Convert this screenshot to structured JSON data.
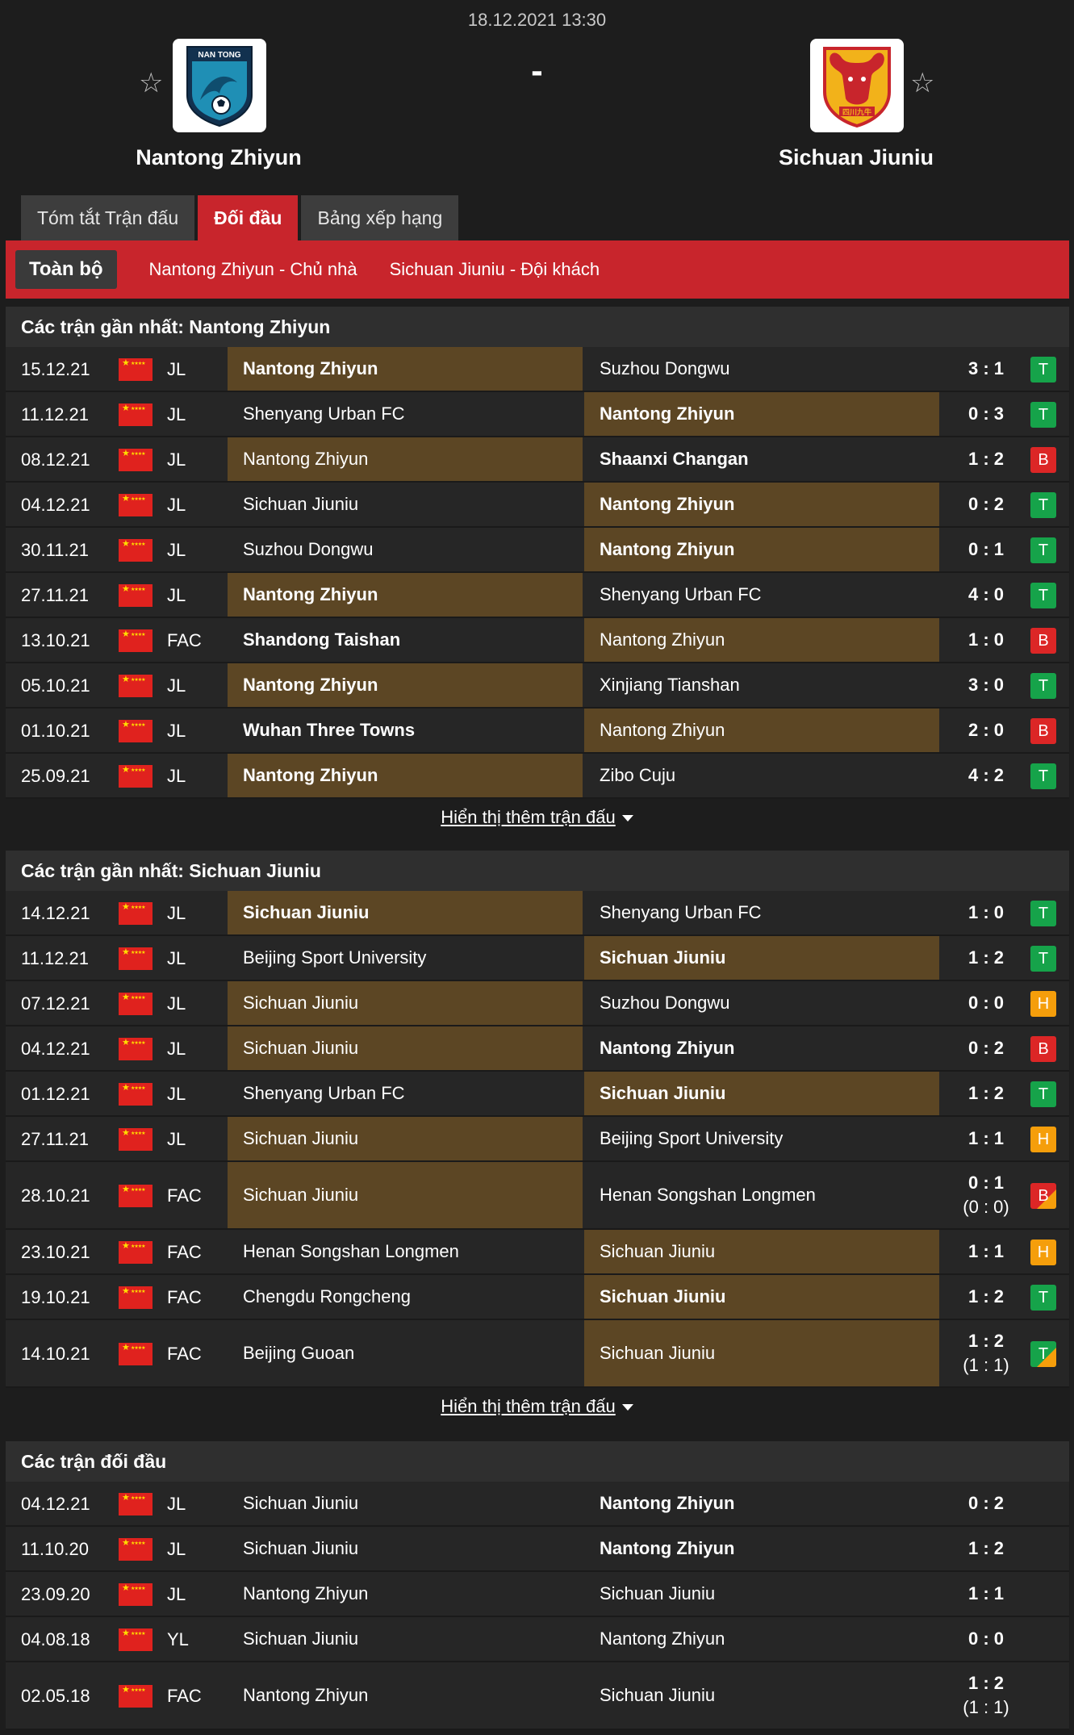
{
  "header": {
    "datetime": "18.12.2021 13:30",
    "score": "-",
    "home_team": "Nantong Zhiyun",
    "away_team": "Sichuan Jiuniu",
    "star_icon": "☆",
    "home_logo_text": "NAN TONG",
    "away_logo_text": "四川九牛"
  },
  "tabs": [
    "Tóm tắt Trận đấu",
    "Đối đầu",
    "Bảng xếp hạng"
  ],
  "subtabs": [
    "Toàn bộ",
    "Nantong Zhiyun - Chủ nhà",
    "Sichuan Jiuniu - Đội khách"
  ],
  "colors": {
    "accent_red": "#c8252c",
    "highlight_brown": "#5c4624",
    "win": "#16a34a",
    "loss": "#dc2626",
    "draw": "#f59e0b"
  },
  "sections": [
    {
      "title": "Các trận gần nhất: Nantong Zhiyun",
      "show_more": "Hiển thị thêm trận đấu",
      "rows": [
        {
          "date": "15.12.21",
          "league": "JL",
          "home": "Nantong Zhiyun",
          "away": "Suzhou Dongwu",
          "score": "3 : 1",
          "sub": "",
          "result": "T",
          "hl": "home",
          "bold": "home"
        },
        {
          "date": "11.12.21",
          "league": "JL",
          "home": "Shenyang Urban FC",
          "away": "Nantong Zhiyun",
          "score": "0 : 3",
          "sub": "",
          "result": "T",
          "hl": "away",
          "bold": "away"
        },
        {
          "date": "08.12.21",
          "league": "JL",
          "home": "Nantong Zhiyun",
          "away": "Shaanxi Changan",
          "score": "1 : 2",
          "sub": "",
          "result": "B",
          "hl": "home",
          "bold": "away"
        },
        {
          "date": "04.12.21",
          "league": "JL",
          "home": "Sichuan Jiuniu",
          "away": "Nantong Zhiyun",
          "score": "0 : 2",
          "sub": "",
          "result": "T",
          "hl": "away",
          "bold": "away"
        },
        {
          "date": "30.11.21",
          "league": "JL",
          "home": "Suzhou Dongwu",
          "away": "Nantong Zhiyun",
          "score": "0 : 1",
          "sub": "",
          "result": "T",
          "hl": "away",
          "bold": "away"
        },
        {
          "date": "27.11.21",
          "league": "JL",
          "home": "Nantong Zhiyun",
          "away": "Shenyang Urban FC",
          "score": "4 : 0",
          "sub": "",
          "result": "T",
          "hl": "home",
          "bold": "home"
        },
        {
          "date": "13.10.21",
          "league": "FAC",
          "home": "Shandong Taishan",
          "away": "Nantong Zhiyun",
          "score": "1 : 0",
          "sub": "",
          "result": "B",
          "hl": "away",
          "bold": "home"
        },
        {
          "date": "05.10.21",
          "league": "JL",
          "home": "Nantong Zhiyun",
          "away": "Xinjiang Tianshan",
          "score": "3 : 0",
          "sub": "",
          "result": "T",
          "hl": "home",
          "bold": "home"
        },
        {
          "date": "01.10.21",
          "league": "JL",
          "home": "Wuhan Three Towns",
          "away": "Nantong Zhiyun",
          "score": "2 : 0",
          "sub": "",
          "result": "B",
          "hl": "away",
          "bold": "home"
        },
        {
          "date": "25.09.21",
          "league": "JL",
          "home": "Nantong Zhiyun",
          "away": "Zibo Cuju",
          "score": "4 : 2",
          "sub": "",
          "result": "T",
          "hl": "home",
          "bold": "home"
        }
      ]
    },
    {
      "title": "Các trận gần nhất: Sichuan Jiuniu",
      "show_more": "Hiển thị thêm trận đấu",
      "rows": [
        {
          "date": "14.12.21",
          "league": "JL",
          "home": "Sichuan Jiuniu",
          "away": "Shenyang Urban FC",
          "score": "1 : 0",
          "sub": "",
          "result": "T",
          "hl": "home",
          "bold": "home"
        },
        {
          "date": "11.12.21",
          "league": "JL",
          "home": "Beijing Sport University",
          "away": "Sichuan Jiuniu",
          "score": "1 : 2",
          "sub": "",
          "result": "T",
          "hl": "away",
          "bold": "away"
        },
        {
          "date": "07.12.21",
          "league": "JL",
          "home": "Sichuan Jiuniu",
          "away": "Suzhou Dongwu",
          "score": "0 : 0",
          "sub": "",
          "result": "H",
          "hl": "home",
          "bold": ""
        },
        {
          "date": "04.12.21",
          "league": "JL",
          "home": "Sichuan Jiuniu",
          "away": "Nantong Zhiyun",
          "score": "0 : 2",
          "sub": "",
          "result": "B",
          "hl": "home",
          "bold": "away"
        },
        {
          "date": "01.12.21",
          "league": "JL",
          "home": "Shenyang Urban FC",
          "away": "Sichuan Jiuniu",
          "score": "1 : 2",
          "sub": "",
          "result": "T",
          "hl": "away",
          "bold": "away"
        },
        {
          "date": "27.11.21",
          "league": "JL",
          "home": "Sichuan Jiuniu",
          "away": "Beijing Sport University",
          "score": "1 : 1",
          "sub": "",
          "result": "H",
          "hl": "home",
          "bold": ""
        },
        {
          "date": "28.10.21",
          "league": "FAC",
          "home": "Sichuan Jiuniu",
          "away": "Henan Songshan Longmen",
          "score": "0 : 1",
          "sub": "(0 : 0)",
          "result": "BH",
          "hl": "home",
          "bold": ""
        },
        {
          "date": "23.10.21",
          "league": "FAC",
          "home": "Henan Songshan Longmen",
          "away": "Sichuan Jiuniu",
          "score": "1 : 1",
          "sub": "",
          "result": "H",
          "hl": "away",
          "bold": ""
        },
        {
          "date": "19.10.21",
          "league": "FAC",
          "home": "Chengdu Rongcheng",
          "away": "Sichuan Jiuniu",
          "score": "1 : 2",
          "sub": "",
          "result": "T",
          "hl": "away",
          "bold": "away"
        },
        {
          "date": "14.10.21",
          "league": "FAC",
          "home": "Beijing Guoan",
          "away": "Sichuan Jiuniu",
          "score": "1 : 2",
          "sub": "(1 : 1)",
          "result": "TH",
          "hl": "away",
          "bold": ""
        }
      ]
    },
    {
      "title": "Các trận đối đầu",
      "show_more": "",
      "rows": [
        {
          "date": "04.12.21",
          "league": "JL",
          "home": "Sichuan Jiuniu",
          "away": "Nantong Zhiyun",
          "score": "0 : 2",
          "sub": "",
          "result": "",
          "hl": "",
          "bold": "away"
        },
        {
          "date": "11.10.20",
          "league": "JL",
          "home": "Sichuan Jiuniu",
          "away": "Nantong Zhiyun",
          "score": "1 : 2",
          "sub": "",
          "result": "",
          "hl": "",
          "bold": "away"
        },
        {
          "date": "23.09.20",
          "league": "JL",
          "home": "Nantong Zhiyun",
          "away": "Sichuan Jiuniu",
          "score": "1 : 1",
          "sub": "",
          "result": "",
          "hl": "",
          "bold": ""
        },
        {
          "date": "04.08.18",
          "league": "YL",
          "home": "Sichuan Jiuniu",
          "away": "Nantong Zhiyun",
          "score": "0 : 0",
          "sub": "",
          "result": "",
          "hl": "",
          "bold": ""
        },
        {
          "date": "02.05.18",
          "league": "FAC",
          "home": "Nantong Zhiyun",
          "away": "Sichuan Jiuniu",
          "score": "1 : 2",
          "sub": "(1 : 1)",
          "result": "",
          "hl": "",
          "bold": ""
        }
      ]
    }
  ]
}
